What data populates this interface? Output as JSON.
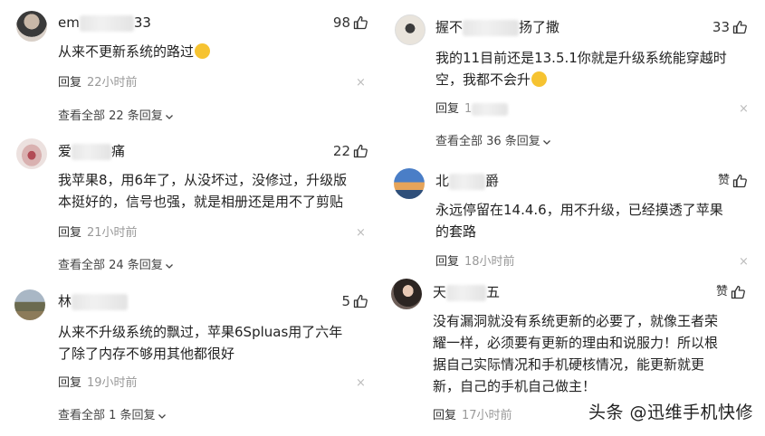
{
  "left": [
    {
      "name_prefix": "em",
      "name_suffix": "33",
      "likes": "98",
      "text": "从来不更新系统的路过",
      "emoji": "laughing-emoji",
      "reply_label": "回复",
      "time": "22小时前",
      "view_all": "查看全部 22 条回复"
    },
    {
      "name_prefix": "爱",
      "name_suffix": "痛",
      "likes": "22",
      "text": "我苹果8，用6年了，从没坏过，没修过，升级版\n本挺好的，信号也强，就是相册还是用不了剪贴",
      "reply_label": "回复",
      "time": "21小时前",
      "view_all": "查看全部 24 条回复"
    },
    {
      "name_prefix": "林",
      "name_suffix": "",
      "likes": "5",
      "text": "从来不升级系统的飘过，苹果6Spluas用了六年\n了除了内存不够用其他都很好",
      "reply_label": "回复",
      "time": "19小时前",
      "view_all": "查看全部 1 条回复"
    }
  ],
  "right": [
    {
      "name_prefix": "握不",
      "name_suffix": "扬了撒",
      "likes": "33",
      "text": "我的11目前还是13.5.1你就是升级系统能穿越时\n空，我都不会升",
      "emoji": "thinking-emoji",
      "reply_label": "回复",
      "time": "1",
      "view_all": "查看全部 36 条回复"
    },
    {
      "name_prefix": "北",
      "name_suffix": "爵",
      "likes": "赞",
      "text": "永远停留在14.4.6，用不升级，已经摸透了苹果\n的套路",
      "reply_label": "回复",
      "time": "18小时前"
    },
    {
      "name_prefix": "天",
      "name_suffix": "五",
      "likes": "赞",
      "text": "没有漏洞就没有系统更新的必要了，就像王者荣\n耀一样，必须要有更新的理由和说服力！所以根\n据自己实际情况和手机硬核情况，能更新就更\n新，自己的手机自己做主！",
      "reply_label": "回复",
      "time": "17小时前"
    }
  ],
  "close_glyph": "×",
  "watermark": "头条 @迅维手机快修",
  "colors": {
    "meta_gray": "#999999",
    "text": "#222222",
    "icon": "#333333"
  }
}
